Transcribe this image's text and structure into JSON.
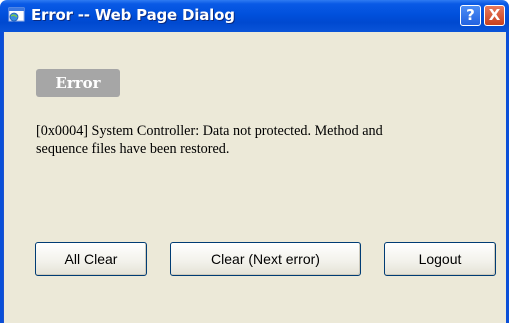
{
  "window": {
    "title": "Error -- Web Page Dialog",
    "help_icon": "?",
    "close_icon": "X"
  },
  "dialog": {
    "badge": "Error",
    "message_line1": "[0x0004] System Controller: Data not protected. Method and",
    "message_line2": "sequence files have been restored."
  },
  "buttons": {
    "all_clear": "All Clear",
    "clear_next": "Clear (Next error)",
    "logout": "Logout"
  },
  "colors": {
    "titlebar": "#0050dc",
    "body": "#ece9d8",
    "badge": "#a6a6a6"
  }
}
